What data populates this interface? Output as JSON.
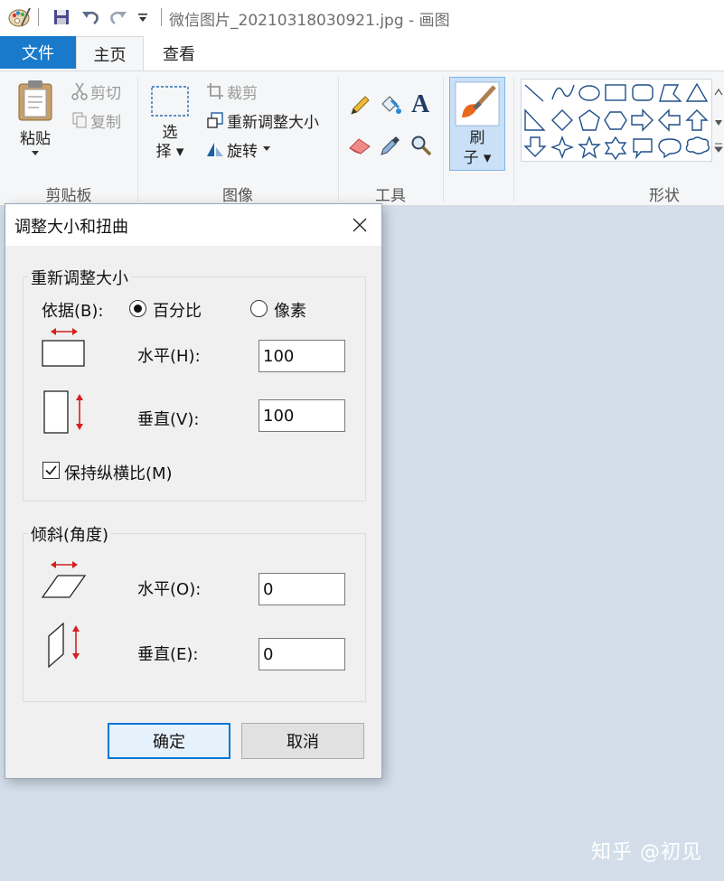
{
  "titlebar": {
    "title": "微信图片_20210318030921.jpg - 画图"
  },
  "tabs": [
    {
      "label": "文件"
    },
    {
      "label": "主页"
    },
    {
      "label": "查看"
    }
  ],
  "ribbon": {
    "clipboard": {
      "paste": "粘贴",
      "cut": "剪切",
      "copy": "复制",
      "group": "剪贴板"
    },
    "image": {
      "select": "选择",
      "crop": "裁剪",
      "resize": "重新调整大小",
      "rotate": "旋转",
      "group": "图像"
    },
    "tools": {
      "group": "工具"
    },
    "brush": {
      "label": "刷子"
    },
    "shapes": {
      "group": "形状"
    }
  },
  "dialog": {
    "title": "调整大小和扭曲",
    "resize": {
      "legend": "重新调整大小",
      "by_label": "依据(B):",
      "percent": "百分比",
      "pixels": "像素",
      "selected": "percent",
      "horizontal_label": "水平(H):",
      "horizontal_value": "100",
      "vertical_label": "垂直(V):",
      "vertical_value": "100",
      "keep_ratio": "保持纵横比(M)",
      "keep_ratio_checked": true
    },
    "skew": {
      "legend": "倾斜(角度)",
      "horizontal_label": "水平(O):",
      "horizontal_value": "0",
      "vertical_label": "垂直(E):",
      "vertical_value": "0"
    },
    "ok": "确定",
    "cancel": "取消"
  },
  "watermark": "知乎 @初见",
  "colors": {
    "accent": "#1979ca",
    "canvas_bg": "#d3deea",
    "ribbon_bg": "#f5f6f7",
    "dialog_bg": "#f0f0f0",
    "arrow_red": "#d42020"
  }
}
